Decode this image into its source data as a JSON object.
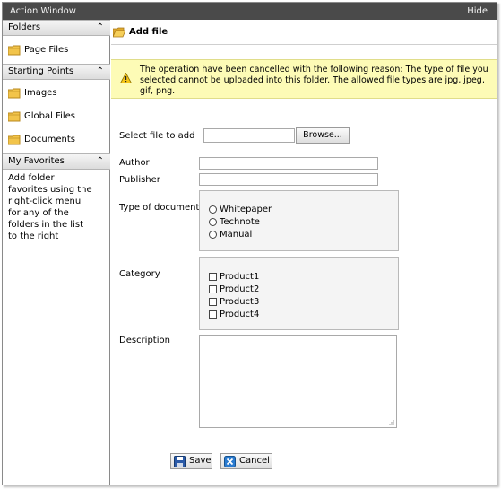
{
  "window": {
    "title": "Action Window",
    "hide_label": "Hide"
  },
  "sidebar": {
    "folders_header": "Folders",
    "folders": [
      {
        "label": "Page Files",
        "icon": "folder-icon"
      }
    ],
    "starting_points_header": "Starting Points",
    "starting_points": [
      {
        "label": "Images",
        "icon": "folder-icon"
      },
      {
        "label": "Global Files",
        "icon": "folder-icon"
      },
      {
        "label": "Documents",
        "icon": "folder-icon"
      }
    ],
    "favorites_header": "My Favorites",
    "favorites_text": "Add folder favorites using the right-click menu for any of the folders in the list to the right",
    "collapse_icon": "double-chevron-up-icon"
  },
  "main": {
    "title": "Add file",
    "warning": "The operation have been cancelled with the following reason: The type of file you selected cannot be uploaded into this folder. The allowed file types are jpg, jpeg, gif, png.",
    "warning_icon": "warning-triangle-icon",
    "form": {
      "select_file_label": "Select file to add",
      "browse_label": "Browse...",
      "file_value": "",
      "author_label": "Author",
      "author_value": "",
      "publisher_label": "Publisher",
      "publisher_value": "",
      "type_label": "Type of document",
      "type_options": [
        "Whitepaper",
        "Technote",
        "Manual"
      ],
      "category_label": "Category",
      "category_options": [
        "Product1",
        "Product2",
        "Product3",
        "Product4"
      ],
      "description_label": "Description",
      "description_value": ""
    },
    "save_label": "Save",
    "cancel_label": "Cancel"
  },
  "colors": {
    "titlebar": "#4a4a4a",
    "warning_bg": "#fdfbb6",
    "folder": "#f2c44a",
    "save_icon": "#2a5aa8",
    "cancel_icon": "#2a7bd0"
  }
}
